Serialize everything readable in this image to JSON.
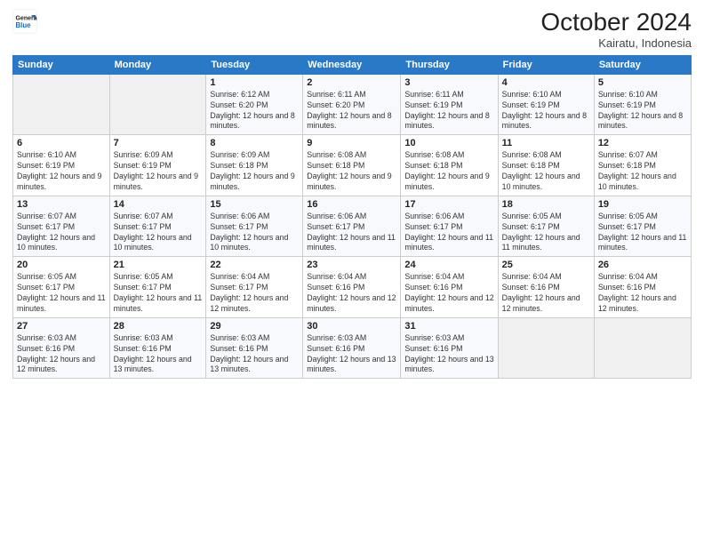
{
  "header": {
    "logo_line1": "General",
    "logo_line2": "Blue",
    "month_title": "October 2024",
    "location": "Kairatu, Indonesia"
  },
  "days_of_week": [
    "Sunday",
    "Monday",
    "Tuesday",
    "Wednesday",
    "Thursday",
    "Friday",
    "Saturday"
  ],
  "weeks": [
    [
      {
        "day": "",
        "info": ""
      },
      {
        "day": "",
        "info": ""
      },
      {
        "day": "1",
        "info": "Sunrise: 6:12 AM\nSunset: 6:20 PM\nDaylight: 12 hours and 8 minutes."
      },
      {
        "day": "2",
        "info": "Sunrise: 6:11 AM\nSunset: 6:20 PM\nDaylight: 12 hours and 8 minutes."
      },
      {
        "day": "3",
        "info": "Sunrise: 6:11 AM\nSunset: 6:19 PM\nDaylight: 12 hours and 8 minutes."
      },
      {
        "day": "4",
        "info": "Sunrise: 6:10 AM\nSunset: 6:19 PM\nDaylight: 12 hours and 8 minutes."
      },
      {
        "day": "5",
        "info": "Sunrise: 6:10 AM\nSunset: 6:19 PM\nDaylight: 12 hours and 8 minutes."
      }
    ],
    [
      {
        "day": "6",
        "info": "Sunrise: 6:10 AM\nSunset: 6:19 PM\nDaylight: 12 hours and 9 minutes."
      },
      {
        "day": "7",
        "info": "Sunrise: 6:09 AM\nSunset: 6:19 PM\nDaylight: 12 hours and 9 minutes."
      },
      {
        "day": "8",
        "info": "Sunrise: 6:09 AM\nSunset: 6:18 PM\nDaylight: 12 hours and 9 minutes."
      },
      {
        "day": "9",
        "info": "Sunrise: 6:08 AM\nSunset: 6:18 PM\nDaylight: 12 hours and 9 minutes."
      },
      {
        "day": "10",
        "info": "Sunrise: 6:08 AM\nSunset: 6:18 PM\nDaylight: 12 hours and 9 minutes."
      },
      {
        "day": "11",
        "info": "Sunrise: 6:08 AM\nSunset: 6:18 PM\nDaylight: 12 hours and 10 minutes."
      },
      {
        "day": "12",
        "info": "Sunrise: 6:07 AM\nSunset: 6:18 PM\nDaylight: 12 hours and 10 minutes."
      }
    ],
    [
      {
        "day": "13",
        "info": "Sunrise: 6:07 AM\nSunset: 6:17 PM\nDaylight: 12 hours and 10 minutes."
      },
      {
        "day": "14",
        "info": "Sunrise: 6:07 AM\nSunset: 6:17 PM\nDaylight: 12 hours and 10 minutes."
      },
      {
        "day": "15",
        "info": "Sunrise: 6:06 AM\nSunset: 6:17 PM\nDaylight: 12 hours and 10 minutes."
      },
      {
        "day": "16",
        "info": "Sunrise: 6:06 AM\nSunset: 6:17 PM\nDaylight: 12 hours and 11 minutes."
      },
      {
        "day": "17",
        "info": "Sunrise: 6:06 AM\nSunset: 6:17 PM\nDaylight: 12 hours and 11 minutes."
      },
      {
        "day": "18",
        "info": "Sunrise: 6:05 AM\nSunset: 6:17 PM\nDaylight: 12 hours and 11 minutes."
      },
      {
        "day": "19",
        "info": "Sunrise: 6:05 AM\nSunset: 6:17 PM\nDaylight: 12 hours and 11 minutes."
      }
    ],
    [
      {
        "day": "20",
        "info": "Sunrise: 6:05 AM\nSunset: 6:17 PM\nDaylight: 12 hours and 11 minutes."
      },
      {
        "day": "21",
        "info": "Sunrise: 6:05 AM\nSunset: 6:17 PM\nDaylight: 12 hours and 11 minutes."
      },
      {
        "day": "22",
        "info": "Sunrise: 6:04 AM\nSunset: 6:17 PM\nDaylight: 12 hours and 12 minutes."
      },
      {
        "day": "23",
        "info": "Sunrise: 6:04 AM\nSunset: 6:16 PM\nDaylight: 12 hours and 12 minutes."
      },
      {
        "day": "24",
        "info": "Sunrise: 6:04 AM\nSunset: 6:16 PM\nDaylight: 12 hours and 12 minutes."
      },
      {
        "day": "25",
        "info": "Sunrise: 6:04 AM\nSunset: 6:16 PM\nDaylight: 12 hours and 12 minutes."
      },
      {
        "day": "26",
        "info": "Sunrise: 6:04 AM\nSunset: 6:16 PM\nDaylight: 12 hours and 12 minutes."
      }
    ],
    [
      {
        "day": "27",
        "info": "Sunrise: 6:03 AM\nSunset: 6:16 PM\nDaylight: 12 hours and 12 minutes."
      },
      {
        "day": "28",
        "info": "Sunrise: 6:03 AM\nSunset: 6:16 PM\nDaylight: 12 hours and 13 minutes."
      },
      {
        "day": "29",
        "info": "Sunrise: 6:03 AM\nSunset: 6:16 PM\nDaylight: 12 hours and 13 minutes."
      },
      {
        "day": "30",
        "info": "Sunrise: 6:03 AM\nSunset: 6:16 PM\nDaylight: 12 hours and 13 minutes."
      },
      {
        "day": "31",
        "info": "Sunrise: 6:03 AM\nSunset: 6:16 PM\nDaylight: 12 hours and 13 minutes."
      },
      {
        "day": "",
        "info": ""
      },
      {
        "day": "",
        "info": ""
      }
    ]
  ]
}
